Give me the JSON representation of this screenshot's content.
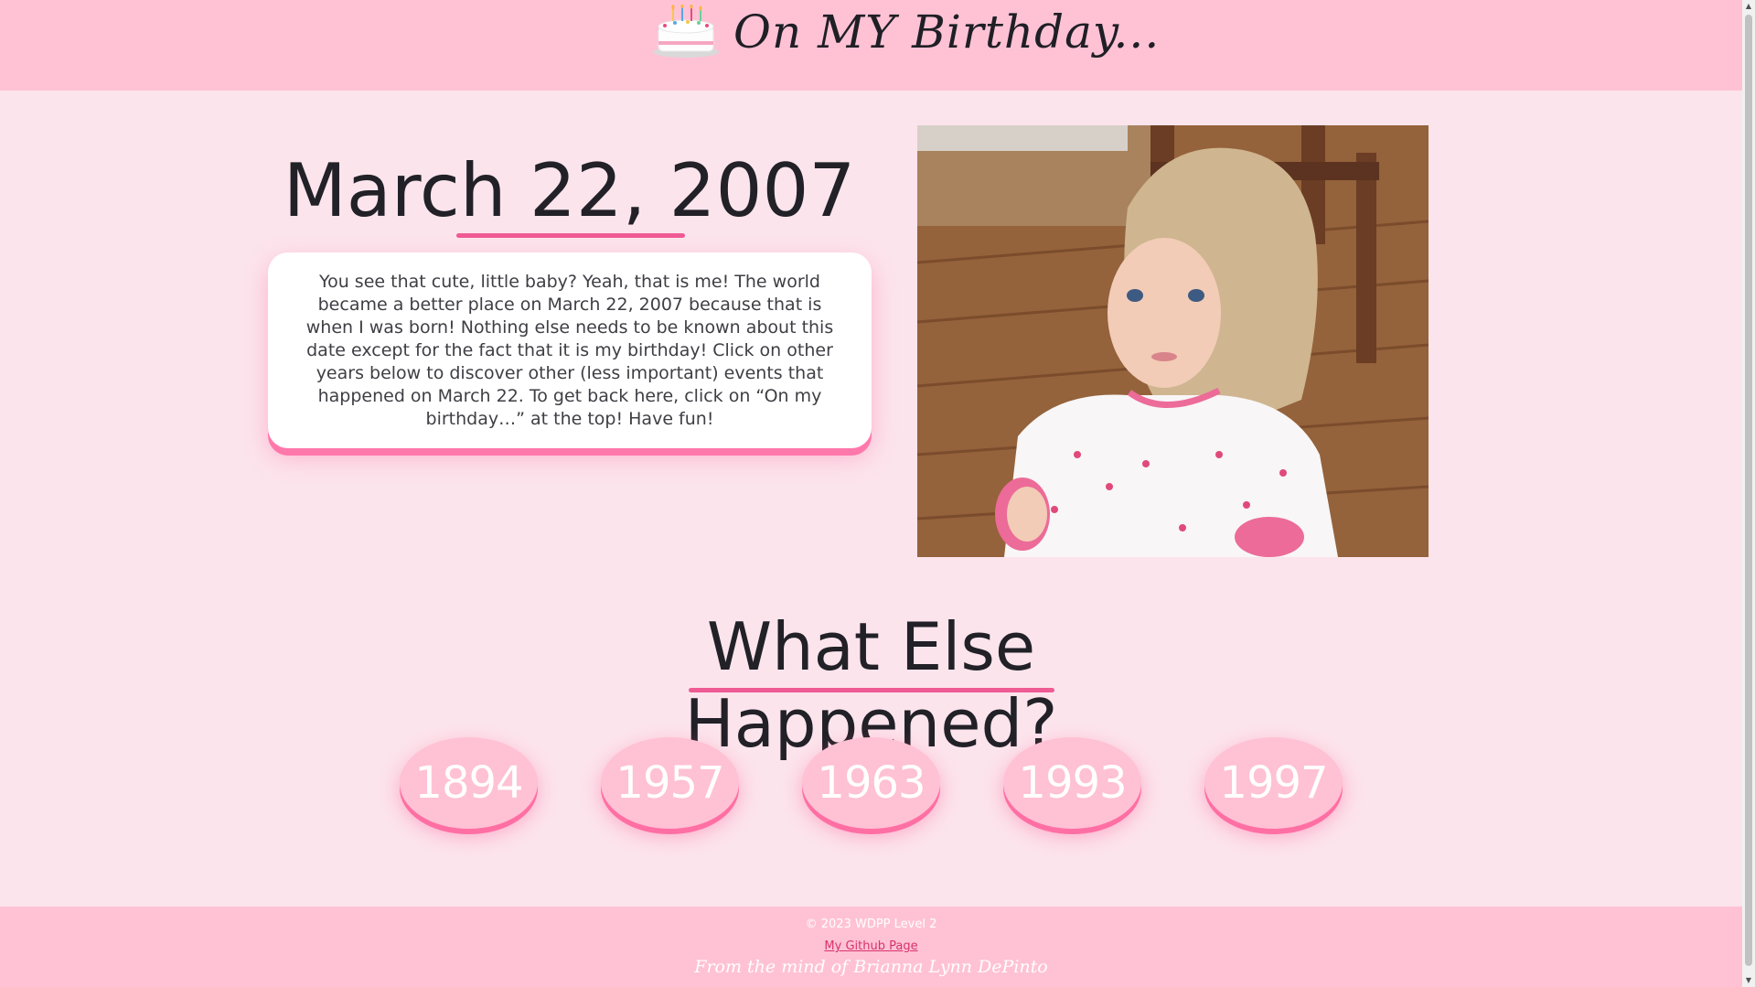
{
  "header": {
    "title": "On MY Birthday...",
    "icon": "birthday-cake-icon"
  },
  "hero": {
    "date": "March 22, 2007",
    "intro": "You see that cute, little baby? Yeah, that is me! The world became a better place on March 22, 2007 because that is when I was born! Nothing else needs to be known about this date except for the fact that it is my birthday! Click on other years below to discover other (less important) events that happened on March 22. To get back here, click on “On my birthday…” at the top! Have fun!"
  },
  "years_section": {
    "title": "What Else Happened?",
    "years": [
      "1894",
      "1957",
      "1963",
      "1993",
      "1997"
    ]
  },
  "footer": {
    "copyright": "© 2023 WDPP Level 2",
    "github_link": "My Github Page",
    "signature": "From the mind of Brianna Lynn DePinto"
  },
  "colors": {
    "header_bg": "#ffc2d5",
    "page_bg": "#fce4ec",
    "accent": "#ef5b94",
    "button_bg": "#ffc1d4"
  }
}
